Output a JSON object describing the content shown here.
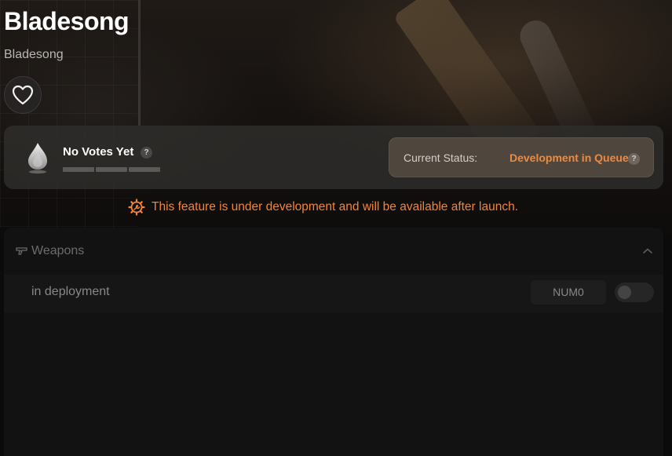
{
  "header": {
    "title": "Bladesong",
    "subtitle": "Bladesong",
    "favorite_icon": "heart-outline-icon"
  },
  "votes": {
    "label": "No Votes Yet",
    "help": "?",
    "icon": "flame-drop-icon",
    "segments": 3
  },
  "status": {
    "label": "Current Status:",
    "value": "Development in Queue",
    "help": "?",
    "value_color": "#f08a3c"
  },
  "notice": {
    "icon": "gear-wrench-icon",
    "text": "This feature is under development and will be available after launch.",
    "color": "#f0843a"
  },
  "weapons": {
    "icon": "pistol-icon",
    "title": "Weapons",
    "collapse_icon": "chevron-up-icon",
    "items": [
      {
        "label": "in deployment",
        "hotkey": "NUM0",
        "enabled": false
      }
    ]
  }
}
